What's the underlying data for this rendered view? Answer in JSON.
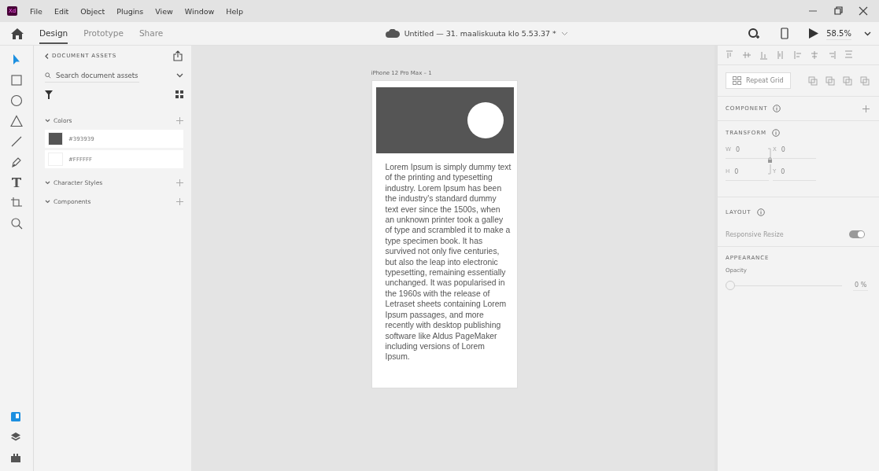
{
  "menu": [
    "File",
    "Edit",
    "Object",
    "Plugins",
    "View",
    "Window",
    "Help"
  ],
  "app_logo": "Xd",
  "tabs": [
    {
      "label": "Design",
      "selected": true
    },
    {
      "label": "Prototype",
      "selected": false
    },
    {
      "label": "Share",
      "selected": false
    }
  ],
  "document_title": "Untitled — 31. maaliskuuta klo 5.53.37 *",
  "zoom": "58.5%",
  "tools": [
    {
      "kind": "select",
      "selected": true
    },
    {
      "kind": "rectangle",
      "selected": false
    },
    {
      "kind": "ellipse",
      "selected": false
    },
    {
      "kind": "triangle",
      "selected": false
    },
    {
      "kind": "line",
      "selected": false
    },
    {
      "kind": "pen",
      "selected": false
    },
    {
      "kind": "text",
      "selected": false
    },
    {
      "kind": "artboard",
      "selected": false
    },
    {
      "kind": "zoom",
      "selected": false
    }
  ],
  "bottom_tools": [
    {
      "kind": "assets",
      "selected": true
    },
    {
      "kind": "layers",
      "selected": false
    },
    {
      "kind": "plugins",
      "selected": false
    }
  ],
  "assets": {
    "title": "DOCUMENT ASSETS",
    "search_placeholder": "Search document assets",
    "sections": [
      {
        "label": "Colors",
        "items": [
          {
            "label": "#393939",
            "color": "#555555"
          },
          {
            "label": "#FFFFFF",
            "color": "#ffffff"
          }
        ]
      },
      {
        "label": "Character Styles"
      },
      {
        "label": "Components"
      }
    ]
  },
  "artboard": {
    "name": "iPhone 12 Pro Max – 1",
    "text": "Lorem Ipsum is simply dummy text of the printing and typesetting industry. Lorem Ipsum has been the industry's standard dummy text ever since the 1500s, when an unknown printer took a galley of type and scrambled it to make a type specimen book. It has survived not only five centuries, but also the leap into electronic typesetting, remaining essentially unchanged. It was popularised in the 1960s with the release of Letraset sheets containing Lorem Ipsum passages, and more recently with desktop publishing software like Aldus PageMaker including versions of Lorem Ipsum."
  },
  "repeat_grid": "Repeat Grid",
  "component_label": "COMPONENT",
  "transform": {
    "label": "TRANSFORM",
    "fields": [
      {
        "label": "W",
        "value": "0"
      },
      {
        "label": "X",
        "value": "0"
      },
      {
        "label": "H",
        "value": "0"
      },
      {
        "label": "Y",
        "value": "0"
      }
    ]
  },
  "layout": {
    "label": "LAYOUT",
    "responsive_resize": "Responsive Resize",
    "on": true
  },
  "appearance": {
    "label": "APPEARANCE",
    "opacity_label": "Opacity",
    "level": 0,
    "opacity_value": "0 %"
  }
}
